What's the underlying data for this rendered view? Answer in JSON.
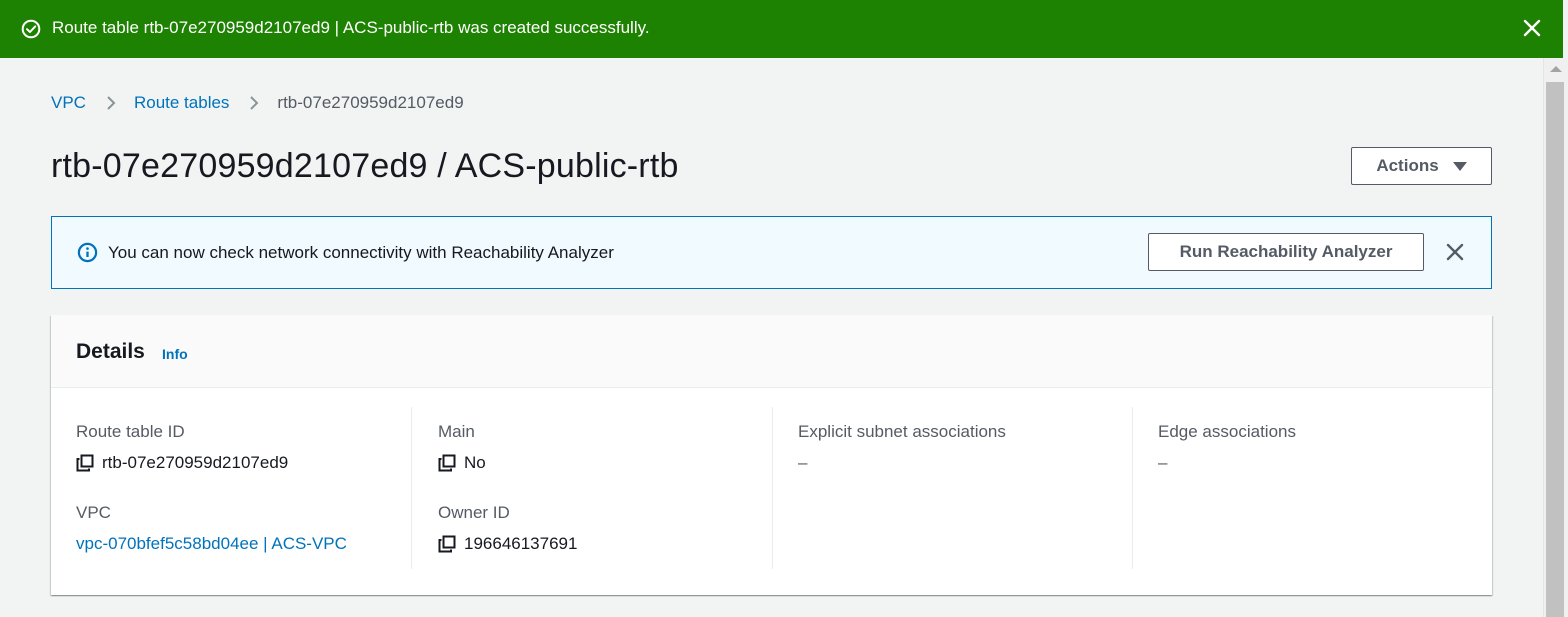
{
  "flash": {
    "message": "Route table rtb-07e270959d2107ed9 | ACS-public-rtb was created successfully.",
    "status_icon": "check-circle-icon",
    "close_icon": "close-icon",
    "color": "#1d8102"
  },
  "breadcrumb": {
    "items": [
      {
        "label": "VPC"
      },
      {
        "label": "Route tables"
      },
      {
        "label": "rtb-07e270959d2107ed9"
      }
    ]
  },
  "header": {
    "title": "rtb-07e270959d2107ed9 / ACS-public-rtb",
    "actions_label": "Actions"
  },
  "alert": {
    "message": "You can now check network connectivity with Reachability Analyzer",
    "button_label": "Run Reachability Analyzer",
    "icon": "info-circle-icon"
  },
  "details": {
    "title": "Details",
    "info_label": "Info",
    "fields": {
      "route_table_id": {
        "label": "Route table ID",
        "value": "rtb-07e270959d2107ed9"
      },
      "vpc": {
        "label": "VPC",
        "value": "vpc-070bfef5c58bd04ee | ACS-VPC"
      },
      "main": {
        "label": "Main",
        "value": "No"
      },
      "owner_id": {
        "label": "Owner ID",
        "value": "196646137691"
      },
      "explicit_subnet": {
        "label": "Explicit subnet associations",
        "value": "–"
      },
      "edge": {
        "label": "Edge associations",
        "value": "–"
      }
    }
  },
  "colors": {
    "link": "#0073bb",
    "success": "#1d8102",
    "info_bg": "#f1faff"
  }
}
